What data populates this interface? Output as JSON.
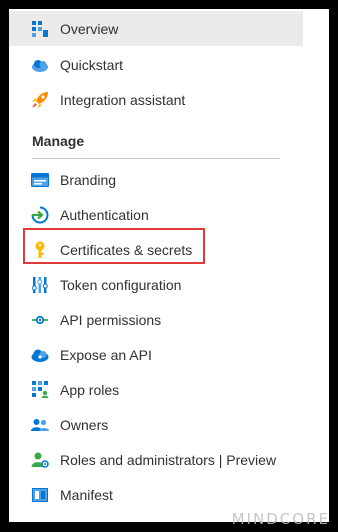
{
  "nav": {
    "items": [
      {
        "label": "Overview",
        "icon": "overview-grid-icon"
      },
      {
        "label": "Quickstart",
        "icon": "cloud-rocket-icon"
      },
      {
        "label": "Integration assistant",
        "icon": "rocket-icon"
      }
    ],
    "manage_header": "Manage",
    "manage_items": [
      {
        "label": "Branding",
        "icon": "branding-card-icon"
      },
      {
        "label": "Authentication",
        "icon": "authentication-arrow-icon"
      },
      {
        "label": "Certificates & secrets",
        "icon": "key-icon"
      },
      {
        "label": "Token configuration",
        "icon": "token-bars-icon"
      },
      {
        "label": "API permissions",
        "icon": "api-permissions-icon"
      },
      {
        "label": "Expose an API",
        "icon": "cloud-api-icon"
      },
      {
        "label": "App roles",
        "icon": "app-roles-grid-icon"
      },
      {
        "label": "Owners",
        "icon": "owners-people-icon"
      },
      {
        "label": "Roles and administrators | Preview",
        "icon": "roles-admin-icon"
      },
      {
        "label": "Manifest",
        "icon": "manifest-icon"
      }
    ]
  },
  "watermark": "MINDCORE",
  "colors": {
    "active_bg": "#edebe9",
    "highlight_border": "#e03a3a",
    "text": "#323130",
    "accent_blue": "#0078d4"
  }
}
